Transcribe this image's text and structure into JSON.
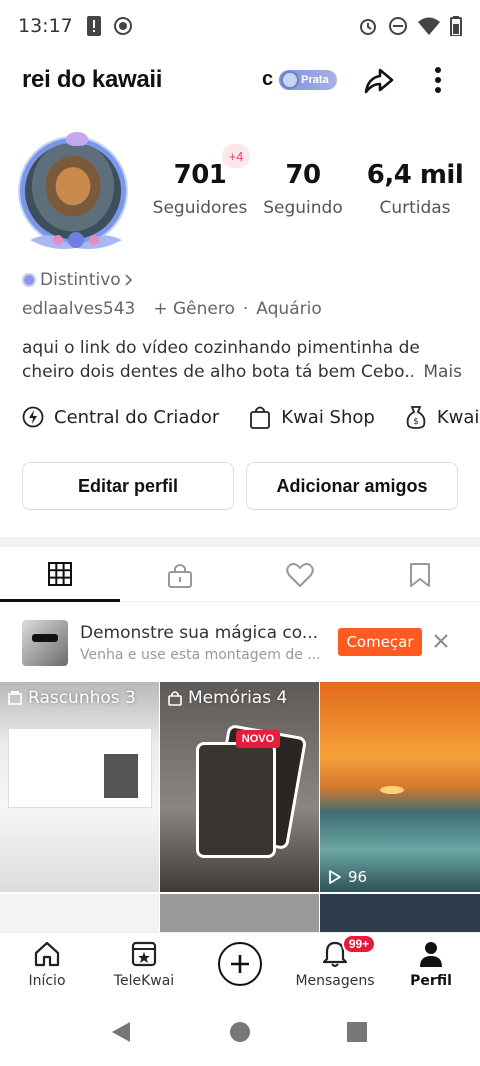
{
  "status_bar": {
    "time": "13:17"
  },
  "header": {
    "profile_name": "rei do kawaii",
    "badge_letter": "c",
    "badge_label": "Prata"
  },
  "avatar": {
    "plus_badge": "+4"
  },
  "stats": [
    {
      "value": "701",
      "label": "Seguidores"
    },
    {
      "value": "70",
      "label": "Seguindo"
    },
    {
      "value": "6,4 mil",
      "label": "Curtidas"
    }
  ],
  "profile": {
    "distintivo": "Distintivo",
    "username": "edlaalves543",
    "gender": "+ Gênero",
    "separator": "·",
    "zodiac": "Aquário",
    "bio": "aqui o link do vídeo cozinhando pimentinha de cheiro dois dentes de alho bota tá bem Cebo...",
    "bio_more": "Mais"
  },
  "shortcuts": [
    {
      "label": "Central do Criador",
      "icon": "bolt-icon"
    },
    {
      "label": "Kwai Shop",
      "icon": "shopping-bag-icon"
    },
    {
      "label": "Kwai G",
      "icon": "money-bag-icon"
    }
  ],
  "buttons": {
    "edit": "Editar perfil",
    "add_friends": "Adicionar amigos"
  },
  "tabs": [
    {
      "icon": "grid-icon",
      "active": true
    },
    {
      "icon": "lock-icon",
      "active": false
    },
    {
      "icon": "heart-icon",
      "active": false
    },
    {
      "icon": "bookmark-icon",
      "active": false
    }
  ],
  "promo": {
    "title": "Demonstre sua mágica co...",
    "subtitle": "Venha e use esta montagem de ...",
    "cta": "Começar"
  },
  "grid": {
    "drafts": "Rascunhos 3",
    "memories": "Memórias 4",
    "new_badge": "NOVO",
    "views": "96"
  },
  "bottom_nav": {
    "home": "Início",
    "telekwai": "TeleKwai",
    "messages": "Mensagens",
    "messages_badge": "99+",
    "profile": "Perfil"
  },
  "colors": {
    "accent": "#ff5a1f",
    "badge_red": "#e81a3a",
    "avatar_ring": "#7b97ea"
  }
}
